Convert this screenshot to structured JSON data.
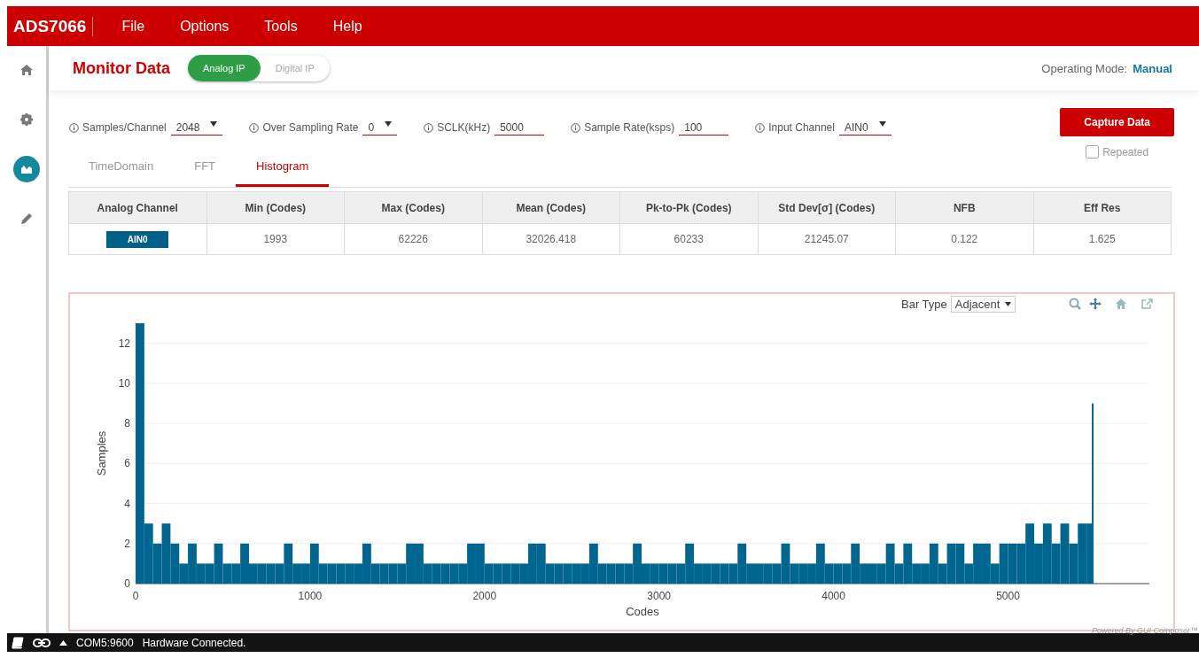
{
  "app": {
    "title": "ADS7066",
    "menu": [
      "File",
      "Options",
      "Tools",
      "Help"
    ]
  },
  "sidebar": {
    "items": [
      {
        "kind": "home",
        "selected": false
      },
      {
        "kind": "settings",
        "selected": false
      },
      {
        "kind": "chart",
        "selected": true
      },
      {
        "kind": "pencil",
        "selected": false
      }
    ]
  },
  "header": {
    "title": "Monitor Data",
    "toggle": [
      {
        "label": "Analog IP",
        "selected": true
      },
      {
        "label": "Digital IP",
        "selected": false
      }
    ],
    "mode_label": "Operating Mode:",
    "mode_value": "Manual"
  },
  "controls": [
    {
      "label": "Samples/Channel",
      "value": "2048",
      "kind": "dropdown"
    },
    {
      "label": "Over Sampling Rate",
      "value": "0",
      "kind": "dropdown"
    },
    {
      "label": "SCLK(kHz)",
      "value": "5000",
      "kind": "input"
    },
    {
      "label": "Sample Rate(ksps)",
      "value": "100",
      "kind": "input"
    },
    {
      "label": "Input Channel",
      "value": "AIN0",
      "kind": "dropdown"
    }
  ],
  "capture_button": "Capture Data",
  "repeated": {
    "label": "Repeated",
    "checked": false
  },
  "tabs": [
    {
      "label": "TimeDomain",
      "selected": false
    },
    {
      "label": "FFT",
      "selected": false
    },
    {
      "label": "Histogram",
      "selected": true
    }
  ],
  "table": {
    "columns": [
      "Analog Channel",
      "Min (Codes)",
      "Max (Codes)",
      "Mean (Codes)",
      "Pk-to-Pk (Codes)",
      "Std Dev[σ] (Codes)",
      "NFB",
      "Eff Res"
    ],
    "rows": [
      {
        "cells": [
          "AIN0",
          "1993",
          "62226",
          "32026.418",
          "60233",
          "21245.07",
          "0.122",
          "1.625"
        ]
      }
    ]
  },
  "chart": {
    "bar_type_label": "Bar Type",
    "bar_type": "Adjacent",
    "powered_by": "Powered By GUI Composer™",
    "chart_data": {
      "type": "bar",
      "grid": true,
      "xlabel": "Codes",
      "ylabel": "Samples",
      "xlim": [
        0,
        5810
      ],
      "ylim": [
        0,
        13
      ],
      "xticks": [
        0,
        1000,
        2000,
        3000,
        4000,
        5000
      ],
      "yticks": [
        0,
        2,
        4,
        6,
        8,
        10,
        12
      ],
      "x": [
        0,
        50,
        100,
        150,
        200,
        250,
        300,
        350,
        400,
        450,
        500,
        550,
        600,
        650,
        700,
        750,
        800,
        850,
        900,
        950,
        1000,
        1050,
        1100,
        1150,
        1200,
        1250,
        1300,
        1350,
        1400,
        1450,
        1500,
        1550,
        1600,
        1650,
        1700,
        1750,
        1800,
        1850,
        1900,
        1950,
        2000,
        2050,
        2100,
        2150,
        2200,
        2250,
        2300,
        2350,
        2400,
        2450,
        2500,
        2550,
        2600,
        2650,
        2700,
        2750,
        2800,
        2850,
        2900,
        2950,
        3000,
        3050,
        3100,
        3150,
        3200,
        3250,
        3300,
        3350,
        3400,
        3450,
        3500,
        3550,
        3600,
        3650,
        3700,
        3750,
        3800,
        3850,
        3900,
        3950,
        4000,
        4050,
        4100,
        4150,
        4200,
        4250,
        4300,
        4350,
        4400,
        4450,
        4500,
        4550,
        4600,
        4650,
        4700,
        4750,
        4800,
        4850,
        4900,
        4950,
        5000,
        5050,
        5100,
        5150,
        5200,
        5250,
        5300,
        5350,
        5400,
        5450,
        5480
      ],
      "values": [
        13,
        3,
        2,
        3,
        2,
        1,
        2,
        1,
        1,
        2,
        1,
        1,
        2,
        1,
        1,
        1,
        1,
        2,
        1,
        1,
        2,
        1,
        1,
        1,
        1,
        1,
        2,
        1,
        1,
        1,
        1,
        2,
        2,
        1,
        1,
        1,
        1,
        1,
        2,
        2,
        1,
        1,
        1,
        1,
        1,
        2,
        2,
        1,
        1,
        1,
        1,
        1,
        2,
        1,
        1,
        1,
        1,
        2,
        1,
        1,
        1,
        1,
        1,
        2,
        1,
        1,
        1,
        1,
        1,
        2,
        1,
        1,
        1,
        1,
        2,
        1,
        1,
        1,
        2,
        1,
        1,
        1,
        2,
        1,
        1,
        1,
        2,
        1,
        2,
        1,
        1,
        2,
        1,
        2,
        2,
        1,
        2,
        2,
        1,
        2,
        2,
        2,
        3,
        2,
        3,
        2,
        3,
        2,
        3,
        3,
        9
      ]
    }
  },
  "status_bar": {
    "port": "COM5:9600",
    "message": "Hardware Connected."
  }
}
